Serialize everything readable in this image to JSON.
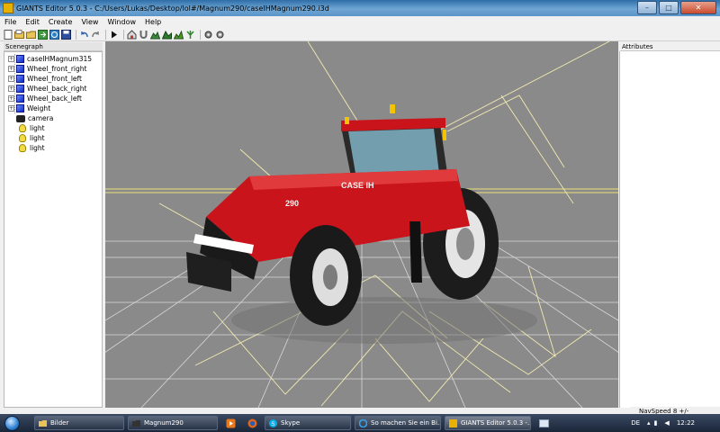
{
  "window": {
    "title": "GIANTS Editor 5.0.3 - C:/Users/Lukas/Desktop/lol#/Magnum290/caseIHMagnum290.i3d",
    "controls": {
      "minimize": "–",
      "maximize": "□",
      "close": "✕"
    }
  },
  "menu": [
    "File",
    "Edit",
    "Create",
    "View",
    "Window",
    "Help"
  ],
  "toolbar": {
    "icons": [
      "new-file-icon",
      "open-file-icon",
      "open-folder-icon",
      "export-icon",
      "reload-icon",
      "save-icon",
      "undo-icon",
      "redo-icon",
      "play-icon",
      "house-icon",
      "magnet-icon",
      "terrain-icon",
      "terrain-edit-icon",
      "terrain-paint-icon",
      "foliage-icon",
      "settings-icon",
      "settings-alt-icon"
    ]
  },
  "scenegraph": {
    "title": "Scenegraph",
    "items": [
      {
        "label": "caseIHMagnum315",
        "icon": "cube-icon",
        "expandable": true
      },
      {
        "label": "Wheel_front_right",
        "icon": "cube-icon",
        "expandable": true
      },
      {
        "label": "Wheel_front_left",
        "icon": "cube-icon",
        "expandable": true
      },
      {
        "label": "Wheel_back_right",
        "icon": "cube-icon",
        "expandable": true
      },
      {
        "label": "Wheel_back_left",
        "icon": "cube-icon",
        "expandable": true
      },
      {
        "label": "Weight",
        "icon": "cube-icon",
        "expandable": true
      },
      {
        "label": "camera",
        "icon": "camera-icon",
        "expandable": false
      },
      {
        "label": "light",
        "icon": "light-icon",
        "expandable": false
      },
      {
        "label": "light",
        "icon": "light-icon",
        "expandable": false
      },
      {
        "label": "light",
        "icon": "light-icon",
        "expandable": false
      }
    ]
  },
  "viewport": {
    "model": {
      "brand": "CASE IH",
      "model_number": "290"
    },
    "background": "#8a8a8a"
  },
  "attributes": {
    "title": "Attributes"
  },
  "status": {
    "nav_speed": "NavSpeed 8 +/-"
  },
  "taskbar": {
    "buttons": [
      {
        "label": "Bilder",
        "icon": "folder-icon",
        "active": false
      },
      {
        "label": "Magnum290",
        "icon": "folder-icon",
        "active": false
      },
      {
        "label": "",
        "icon": "media-player-icon",
        "active": false
      },
      {
        "label": "",
        "icon": "firefox-icon",
        "active": false
      },
      {
        "label": "Skype",
        "icon": "skype-icon",
        "active": false
      },
      {
        "label": "So machen Sie ein Bi...",
        "icon": "ie-icon",
        "active": false
      },
      {
        "label": "GIANTS Editor 5.0.3 -...",
        "icon": "giants-icon",
        "active": true
      },
      {
        "label": "",
        "icon": "window-icon",
        "active": false
      }
    ],
    "language": "DE",
    "time": "12:22"
  },
  "colors": {
    "title_bar": "#4f86bd",
    "tractor_red": "#c8141a",
    "gizmo_yellow": "#e8e07a",
    "light_lines": "#f3ecb0",
    "grid": "#dcdcdc"
  }
}
